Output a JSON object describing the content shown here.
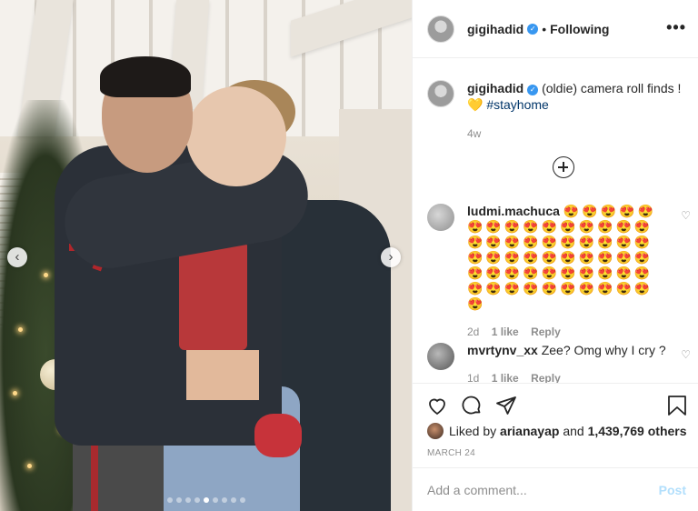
{
  "post": {
    "username": "gigihadid",
    "separator": "•",
    "following_label": "Following",
    "more_label": "•••",
    "media": {
      "dots": 9,
      "active_dot": 4
    }
  },
  "caption": {
    "username": "gigihadid",
    "text": "(oldie) camera roll finds !",
    "emoji": "💛",
    "hashtag": "#stayhome",
    "time": "4w"
  },
  "comments": [
    {
      "username": "ludmi.machuca",
      "emojis": "😍😍😍😍😍😍😍😍😍😍😍😍😍😍😍😍😍😍😍😍😍😍😍😍😍😍😍😍😍😍😍😍😍😍😍😍😍😍😍😍😍😍😍😍😍😍😍😍😍😍😍😍😍😍😍😍",
      "time": "2d",
      "likes": "1 like",
      "reply": "Reply"
    },
    {
      "username": "mvrtynv_xx",
      "text": "Zee? Omg why I cry ?",
      "time": "1d",
      "likes": "1 like",
      "reply": "Reply"
    }
  ],
  "likes": {
    "prefix": "Liked by",
    "user": "arianayap",
    "middle": "and",
    "count": "1,439,769 others"
  },
  "date": "MARCH 24",
  "add_comment": {
    "placeholder": "Add a comment...",
    "post_label": "Post"
  },
  "colors": {
    "verified": "#3897f0",
    "post_disabled": "#b2dffc",
    "hashtag": "#003569"
  }
}
